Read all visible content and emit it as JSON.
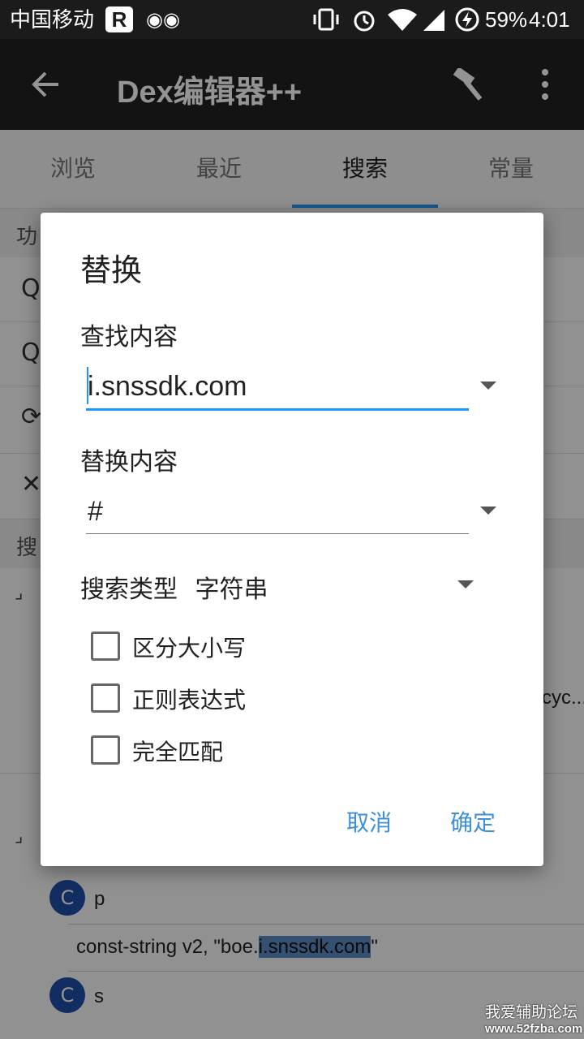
{
  "status_bar": {
    "carrier": "中国移动",
    "battery": "59%",
    "time": "4:01"
  },
  "app_bar": {
    "title": "Dex编辑器++"
  },
  "tabs": [
    {
      "label": "浏览"
    },
    {
      "label": "最近"
    },
    {
      "label": "搜索"
    },
    {
      "label": "常量"
    }
  ],
  "background": {
    "section1_fragment": "功",
    "section2_fragment": "搜",
    "cut_text": "cyc...",
    "list": [
      {
        "badge": "C",
        "name": "p"
      },
      {
        "code_prefix": "const-string v2, \"boe.",
        "code_match": "i.snssdk.com",
        "code_suffix": "\""
      },
      {
        "badge": "C",
        "name": "s"
      }
    ]
  },
  "dialog": {
    "title": "替换",
    "find_label": "查找内容",
    "find_value": "i.snssdk.com",
    "replace_label": "替换内容",
    "replace_value": "#",
    "search_type_label": "搜索类型",
    "search_type_value": "字符串",
    "options": [
      {
        "label": "区分大小写",
        "checked": false
      },
      {
        "label": "正则表达式",
        "checked": false
      },
      {
        "label": "完全匹配",
        "checked": false
      }
    ],
    "cancel": "取消",
    "confirm": "确定"
  },
  "watermark": {
    "line1": "我爱辅助论坛",
    "line2": "www.52fzba.com"
  },
  "colors": {
    "accent": "#2196f3",
    "dialog_button": "#3d8fd6",
    "app_bar": "#212121"
  }
}
